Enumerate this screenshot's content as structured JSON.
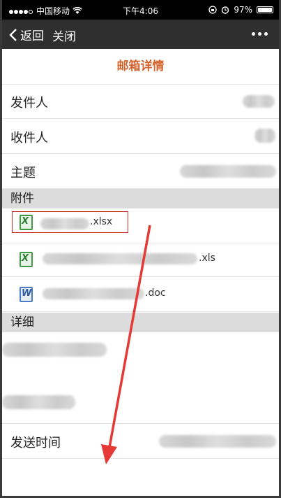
{
  "status_bar": {
    "carrier": "中国移动",
    "time": "下午4:06",
    "battery": "97%"
  },
  "nav": {
    "back_label": "返回",
    "close_label": "关闭"
  },
  "page": {
    "title": "邮箱详情"
  },
  "fields": {
    "sender_label": "发件人",
    "recipient_label": "收件人",
    "subject_label": "主题",
    "send_time_label": "发送时间"
  },
  "attachments_header": "附件",
  "attachments": [
    {
      "ext": ".xlsx",
      "type": "xls",
      "icon": "excel-file-icon"
    },
    {
      "ext": ".xls",
      "type": "xls",
      "icon": "excel-file-icon"
    },
    {
      "ext": ".doc",
      "type": "doc",
      "icon": "word-file-icon"
    }
  ],
  "details_header": "详细",
  "colors": {
    "title_accent": "#d4652f",
    "highlight": "#d12b2b",
    "arrow": "#e53935"
  }
}
